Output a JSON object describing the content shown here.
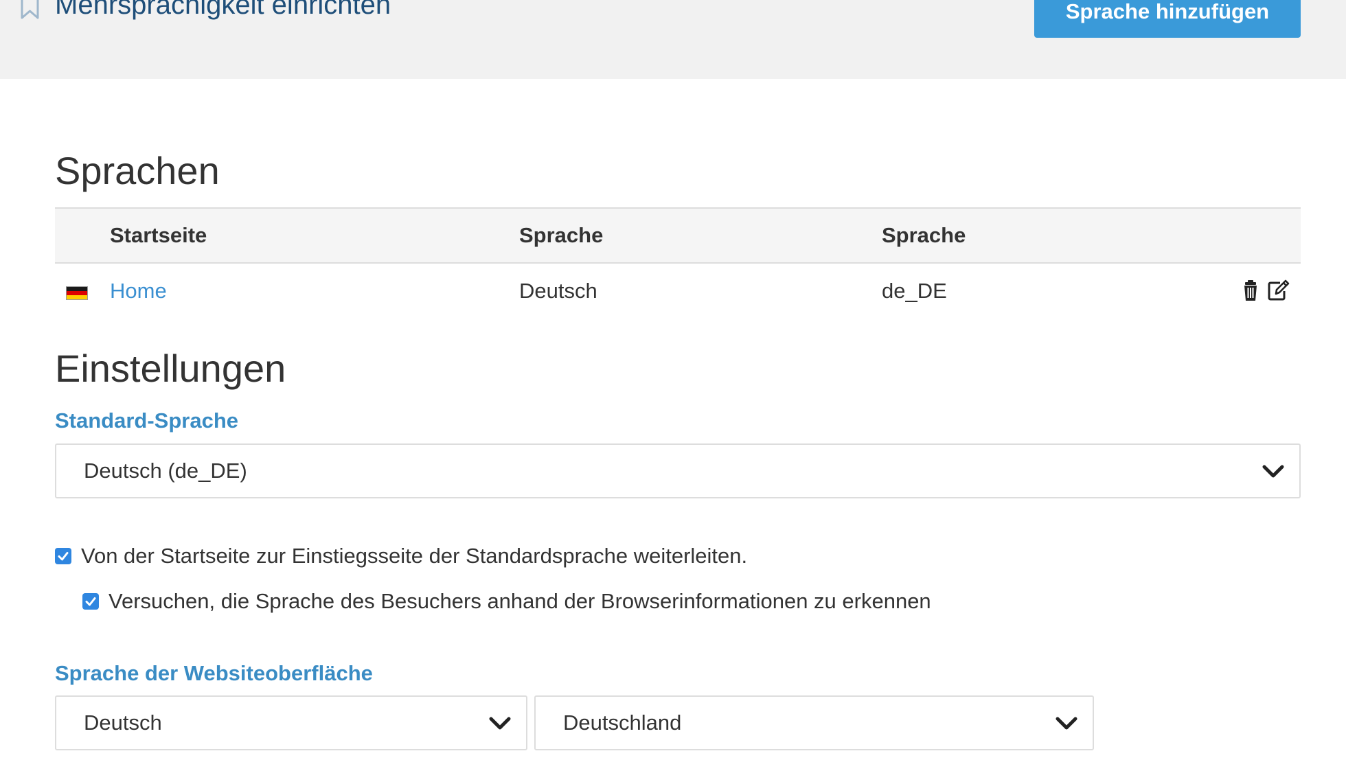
{
  "header": {
    "title": "Mehrsprachigkeit einrichten",
    "add_language_button": "Sprache hinzufügen",
    "bookmark_icon": "bookmark-icon"
  },
  "languages_section": {
    "title": "Sprachen",
    "columns": [
      "Startseite",
      "Sprache",
      "Sprache"
    ],
    "rows": [
      {
        "flag_icon": "flag-de-icon",
        "startpage": "Home",
        "language": "Deutsch",
        "locale": "de_DE",
        "actions": [
          "trash-icon",
          "edit-icon"
        ]
      }
    ]
  },
  "settings_section": {
    "title": "Einstellungen",
    "default_language": {
      "label": "Standard-Sprache",
      "selected": "Deutsch (de_DE)"
    },
    "redirect_checkbox": {
      "label": "Von der Startseite zur Einstiegsseite der Standardsprache weiterleiten.",
      "checked": true
    },
    "detect_checkbox": {
      "label": "Versuchen, die Sprache des Besuchers anhand der Browserinformationen zu erkennen",
      "checked": true
    },
    "interface_language": {
      "label": "Sprache der Websiteoberfläche",
      "language_selected": "Deutsch",
      "country_selected": "Deutschland"
    }
  },
  "colors": {
    "accent_button": "#3a9ad9",
    "title_blue": "#1e4e79",
    "label_blue": "#3a8cc4",
    "link_blue": "#3a8fd1",
    "checkbox_blue": "#2f86e0"
  }
}
